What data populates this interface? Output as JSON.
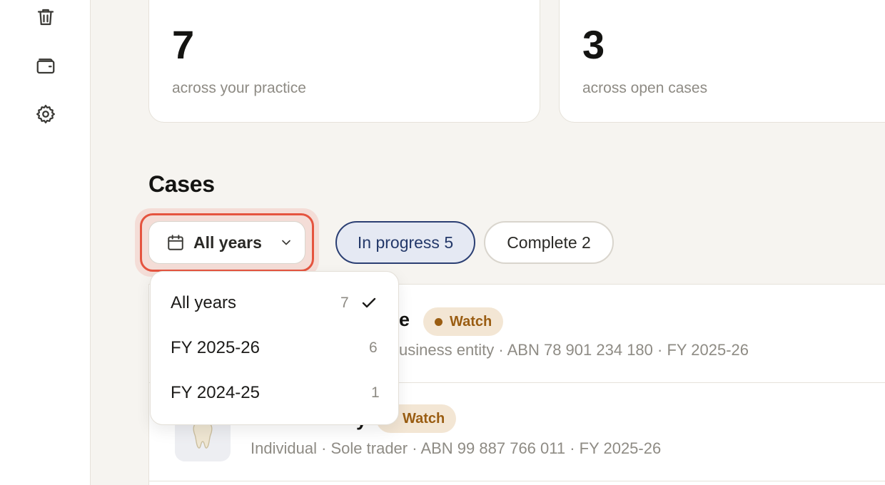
{
  "sidebar": {
    "icons": [
      "trash-icon",
      "wallet-icon",
      "gear-icon"
    ]
  },
  "stats": [
    {
      "value": "7",
      "caption": "across your practice"
    },
    {
      "value": "3",
      "caption": "across open cases"
    }
  ],
  "cases_section": {
    "title": "Cases",
    "year_filter": {
      "label": "All years",
      "icon": "calendar-icon"
    },
    "status_pills": [
      {
        "label": "In progress 5",
        "active": true
      },
      {
        "label": "Complete 2",
        "active": false
      }
    ]
  },
  "year_dropdown": {
    "options": [
      {
        "label": "All years",
        "count": "7",
        "selected": true
      },
      {
        "label": "FY 2025-26",
        "count": "6",
        "selected": false
      },
      {
        "label": "FY 2024-25",
        "count": "1",
        "selected": false
      }
    ]
  },
  "case_rows": [
    {
      "name_fragment": "e",
      "badge": "Watch",
      "meta_fragment": "usiness entity · ABN 78 901 234 180 · FY 2025-26"
    },
    {
      "name_fragment": "y",
      "badge": "Watch",
      "meta": "Individual · Sole trader · ABN 99 887 766 011 · FY 2025-26",
      "thumb_icon": "tooth-icon"
    }
  ],
  "colors": {
    "page_bg": "#f6f4f0",
    "focus_ring": "#e5543f",
    "active_pill_border": "#2b3f73",
    "active_pill_bg": "#e5e9f3",
    "watch_badge_bg": "#f3e6d4",
    "watch_badge_text": "#9a5d12"
  }
}
